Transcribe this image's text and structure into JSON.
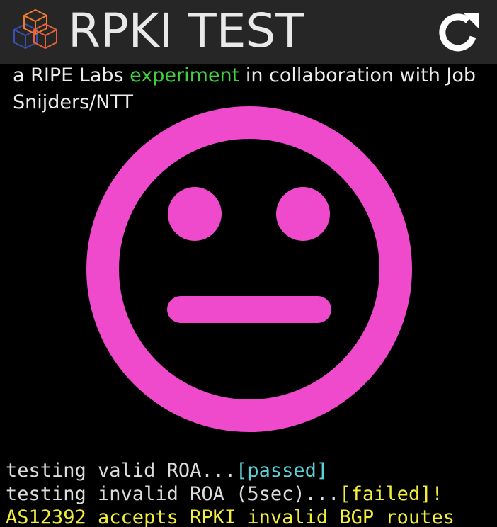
{
  "header": {
    "title": "RPKI TEST",
    "logo_icon": "ripe-cube-logo-icon",
    "reload_icon": "refresh-icon"
  },
  "subtitle": {
    "prefix": "a RIPE Labs ",
    "link_text": "experiment",
    "suffix": " in collaboration with Job Snijders/NTT"
  },
  "status_face": {
    "icon": "neutral-face-icon",
    "color": "#ee4acb"
  },
  "console": {
    "line1_text": "testing valid ROA...",
    "line1_status": "[passed]",
    "line2_text": "testing invalid ROA (5sec)...",
    "line2_status": "[failed]!",
    "line3_text": "AS12392 accepts RPKI invalid BGP routes"
  },
  "colors": {
    "header_bg": "#262626",
    "link": "#3fcf3f",
    "passed": "#5ad0d8",
    "failed": "#f2ee3a",
    "face": "#ee4acb"
  }
}
